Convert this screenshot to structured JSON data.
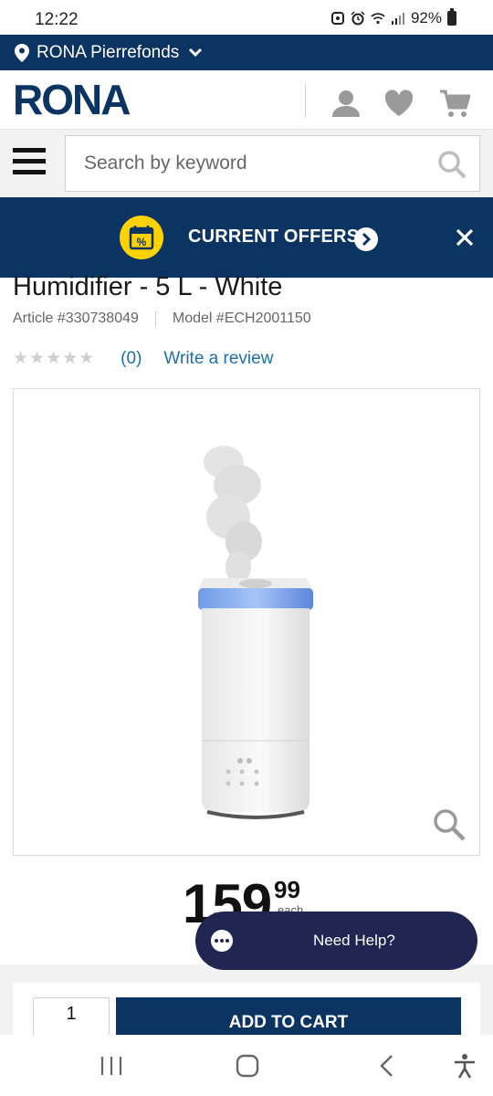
{
  "status_bar": {
    "time": "12:22",
    "battery": "92%",
    "icons": [
      "app-notification-icon",
      "alarm-icon",
      "wifi-icon",
      "signal-icon",
      "battery-icon"
    ]
  },
  "store_bar": {
    "store_name": "RONA Pierrefonds",
    "icons": [
      "location-pin-icon",
      "chevron-down-icon"
    ]
  },
  "header": {
    "logo_text": "RONA",
    "icons": [
      "account-icon",
      "wishlist-heart-icon",
      "cart-icon"
    ]
  },
  "search": {
    "placeholder": "Search by keyword",
    "icons": [
      "menu-icon",
      "search-icon"
    ]
  },
  "offers_banner": {
    "label": "CURRENT OFFERS",
    "icons": [
      "calendar-percent-icon",
      "arrow-right-icon",
      "close-icon"
    ]
  },
  "product": {
    "title": "Humidifier - 5 L - White",
    "article": "Article #330738049",
    "model": "Model #ECH2001150",
    "stars": "★★★★★",
    "rating_value": 0,
    "review_count": "(0)",
    "write_review": "Write a review",
    "price_main": "159",
    "price_cents": "99",
    "price_unit": "each"
  },
  "help": {
    "label": "Need Help?",
    "icon": "chat-icon"
  },
  "cart": {
    "quantity": "1",
    "add_to_cart": "ADD TO CART"
  },
  "nav_bar": {
    "icons": [
      "recent-apps-icon",
      "home-icon",
      "back-icon",
      "accessibility-icon"
    ]
  },
  "colors": {
    "brand_navy": "#0b3462",
    "link_blue": "#1c6fae",
    "offer_yellow": "#ffd200",
    "help_navy": "#202552"
  }
}
